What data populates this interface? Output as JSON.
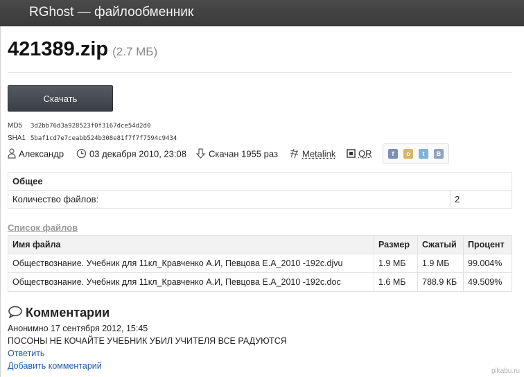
{
  "header": {
    "brand": "RGhost — файлообменник"
  },
  "file": {
    "name": "421389.zip",
    "size": "(2.7 МБ)"
  },
  "download": {
    "label": "Скачать"
  },
  "hashes": [
    {
      "key": "MD5",
      "value": "3d2bb76d3a928523f0f3167dce54d2d0"
    },
    {
      "key": "SHA1",
      "value": "5baf1cd7e7ceabb524b308e81f7f7f7594c9434"
    }
  ],
  "meta": {
    "author": "Александр",
    "date": "03 декабря 2010, 23:08",
    "downloads": "Скачан 1955 раз",
    "metalink": "Metalink",
    "qr": "QR"
  },
  "social": [
    {
      "name": "facebook-icon",
      "color": "#7b8fb8",
      "glyph": "f"
    },
    {
      "name": "odnoklassniki-icon",
      "color": "#d9b56a",
      "glyph": "o"
    },
    {
      "name": "twitter-icon",
      "color": "#7fb2d8",
      "glyph": "t"
    },
    {
      "name": "vkontakte-icon",
      "color": "#8ea3bf",
      "glyph": "B"
    }
  ],
  "general": {
    "heading": "Общее",
    "rows": [
      {
        "label": "Количество файлов:",
        "value": "2"
      }
    ]
  },
  "files": {
    "link": "Список файлов",
    "columns": [
      "Имя файла",
      "Размер",
      "Сжатый",
      "Процент"
    ],
    "rows": [
      [
        "Обществознание. Учебник для 11кл_Кравченко А.И, Певцова Е.А_2010 -192с.djvu",
        "1.9 МБ",
        "1.9 МБ",
        "99.004%"
      ],
      [
        "Обществознание. Учебник для 11кл_Кравченко А.И, Певцова Е.А_2010 -192с.doc",
        "1.6 МБ",
        "788.9 КБ",
        "49.509%"
      ]
    ]
  },
  "comments": {
    "heading": "Комментарии",
    "items": [
      {
        "meta": "Анонимно 17 сентября 2012, 15:45",
        "text": "ПОСОНЫ НЕ КОЧАЙТЕ УЧЕБНИК УБИЛ УЧИТЕЛЯ ВСЕ РАДУЮТСЯ"
      }
    ],
    "reply": "Ответить",
    "add": "Добавить комментарий"
  },
  "watermark": "pikabu.ru"
}
